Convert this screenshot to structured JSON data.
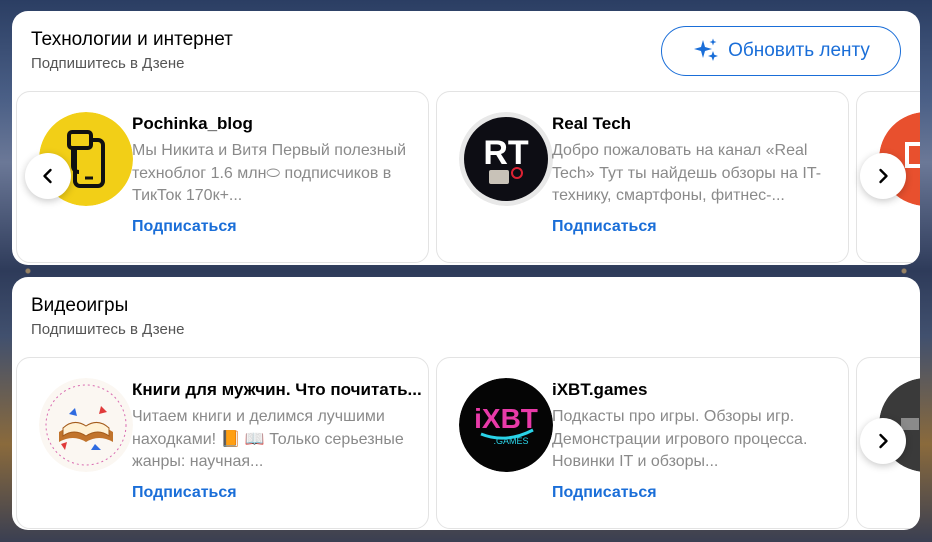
{
  "colors": {
    "accent": "#1a6ed8",
    "title": "#000000",
    "muted": "#8a8a8a"
  },
  "sections": [
    {
      "title": "Технологии и интернет",
      "subtitle": "Подпишитесь в Дзене",
      "refresh_label": "Обновить ленту",
      "channels": [
        {
          "name": "Pochinka_blog",
          "description": "Мы Никита    и Витя    Первый полезный техноблог 1.6 млн⬭ подписчиков в ТикТок 170к+...",
          "subscribe_label": "Подписаться",
          "avatar_icon": "phone-repair-logo-icon"
        },
        {
          "name": "Real Tech",
          "description": "Добро пожаловать на канал «Real Tech» Тут ты найдешь обзоры на IT-технику, смартфоны, фитнес-...",
          "subscribe_label": "Подписаться",
          "avatar_icon": "rt-robot-hand-logo-icon"
        }
      ]
    },
    {
      "title": "Видеоигры",
      "subtitle": "Подпишитесь в Дзене",
      "channels": [
        {
          "name": "Книги для мужчин. Что почитать...",
          "description": "Читаем книги и делимся лучшими находками! 📙 📖 Только серьезные жанры: научная...",
          "subscribe_label": "Подписаться",
          "avatar_icon": "open-book-logo-icon"
        },
        {
          "name": "iXBT.games",
          "description": "Подкасты про игры. Обзоры игр. Демонстрации игрового процесса. Новинки IT и обзоры...",
          "subscribe_label": "Подписаться",
          "avatar_icon": "ixbt-games-logo-icon"
        }
      ]
    }
  ],
  "logos": {
    "rt": "RT",
    "ixbt": "iXBT",
    "ixbt_sub": ".GAMES"
  }
}
